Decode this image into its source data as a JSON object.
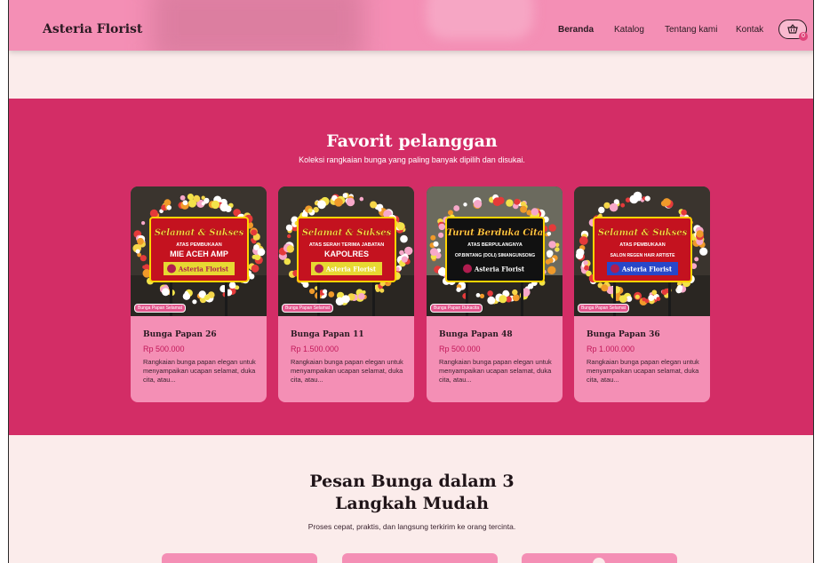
{
  "header": {
    "brand": "Asteria Florist",
    "nav": [
      "Beranda",
      "Katalog",
      "Tentang kami",
      "Kontak"
    ],
    "cart_count": "0"
  },
  "favorites": {
    "title": "Favorit pelanggan",
    "subtitle": "Koleksi rangkaian bunga yang paling banyak dipilih dan disukai.",
    "cards": [
      {
        "tag": "Bunga Papan Selamat",
        "name": "Bunga Papan 26",
        "price": "Rp 500.000",
        "desc": "Rangkaian bunga papan elegan untuk menyampaikan ucapan selamat, duka cita, atau...",
        "board_line1": "Selamat & Sukses",
        "board_line2": "ATAS PEMBUKAAN",
        "board_line3": "MIE ACEH AMP",
        "board_brand": "Asteria Florist",
        "board_color": "#c4121f"
      },
      {
        "tag": "Bunga Papan Selamat",
        "name": "Bunga Papan 11",
        "price": "Rp 1.500.000",
        "desc": "Rangkaian bunga papan elegan untuk menyampaikan ucapan selamat, duka cita, atau...",
        "board_line1": "Selamat & Sukses",
        "board_line2": "ATAS SERAH TERIMA JABATAN",
        "board_line3": "KAPOLRES",
        "board_brand": "Asteria Florist",
        "board_color": "#c4121f"
      },
      {
        "tag": "Bunga Papan Dukacita",
        "name": "Bunga Papan 48",
        "price": "Rp 500.000",
        "desc": "Rangkaian bunga papan elegan untuk menyampaikan ucapan selamat, duka cita, atau...",
        "board_line1": "Turut Berduka Cita",
        "board_line2": "ATAS BERPULANGNYA",
        "board_line3": "OP.BINTANG (DOLI) SIMANGUNSONG",
        "board_brand": "Asteria Florist",
        "board_color": "#111111"
      },
      {
        "tag": "Bunga Papan Selamat",
        "name": "Bunga Papan 36",
        "price": "Rp 1.000.000",
        "desc": "Rangkaian bunga papan elegan untuk menyampaikan ucapan selamat, duka cita, atau...",
        "board_line1": "Selamat & Sukses",
        "board_line2": "ATAS PEMBUKAAN",
        "board_line3": "SALON REGEN HAIR ARTISTE",
        "board_brand": "Asteria Florist",
        "board_color": "#c4121f"
      }
    ]
  },
  "steps": {
    "title": "Pesan Bunga dalam 3 Langkah Mudah",
    "subtitle": "Proses cepat, praktis, dan langsung terkirim ke orang tercinta."
  },
  "colors": {
    "header_bg": "#f48fb5",
    "section_bg": "#d32d66",
    "page_bg": "#fbeceb",
    "card_bg": "#f48fb5",
    "price": "#c2195a"
  }
}
